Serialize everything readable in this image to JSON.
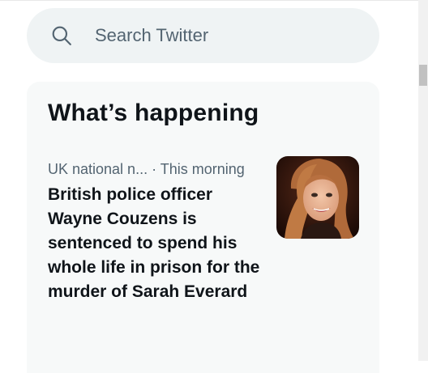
{
  "search": {
    "placeholder": "Search Twitter",
    "icon": "search-icon"
  },
  "whats_happening": {
    "title": "What’s happening",
    "trends": [
      {
        "category": "UK national n...",
        "separator": "·",
        "time": "This morning",
        "headline": "British police officer Wayne Couzens is sentenced to spend his whole life in prison for the murder of Sarah Everard",
        "thumbnail": "portrait-photo"
      }
    ]
  },
  "colors": {
    "search_bg": "#eff3f4",
    "panel_bg": "#f7f9f9",
    "text_primary": "#0f1419",
    "text_secondary": "#536471"
  }
}
